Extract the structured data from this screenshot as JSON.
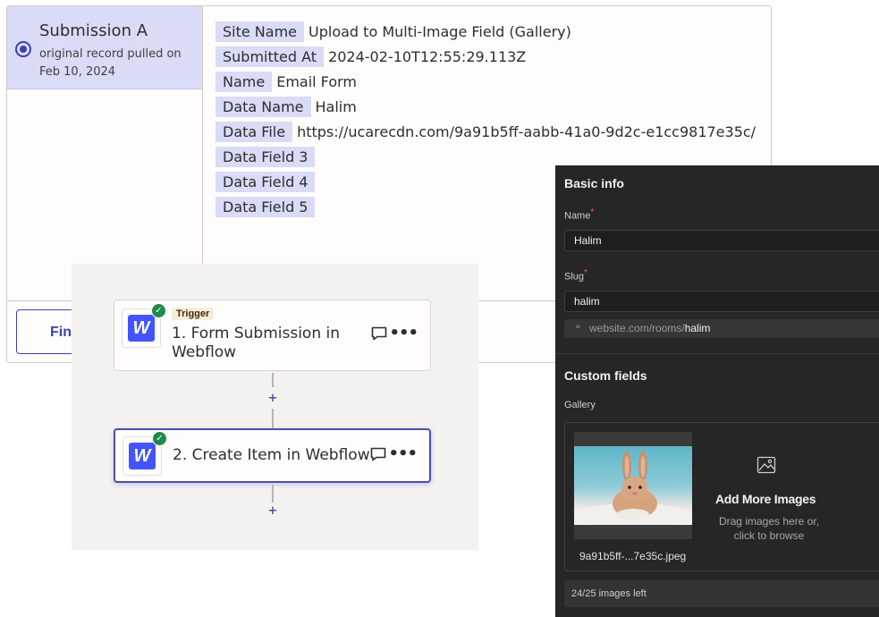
{
  "submission": {
    "title": "Submission A",
    "description": "original record pulled on Feb 10, 2024",
    "find_button": "Fin",
    "fields": [
      {
        "label": "Site Name",
        "value": "Upload to Multi-Image Field (Gallery)"
      },
      {
        "label": "Submitted At",
        "value": "2024-02-10T12:55:29.113Z"
      },
      {
        "label": "Name",
        "value": "Email Form"
      },
      {
        "label": "Data Name",
        "value": "Halim"
      },
      {
        "label": "Data File",
        "value": "https://ucarecdn.com/9a91b5ff-aabb-41a0-9d2c-e1cc9817e35c/"
      },
      {
        "label": "Data Field 3",
        "value": ""
      },
      {
        "label": "Data Field 4",
        "value": ""
      },
      {
        "label": "Data Field 5",
        "value": ""
      }
    ]
  },
  "zap": {
    "steps": [
      {
        "badge": "Trigger",
        "title": "1. Form Submission in Webflow",
        "app_letter": "W"
      },
      {
        "badge": "",
        "title": "2. Create Item in Webflow",
        "app_letter": "W"
      }
    ],
    "plus": "+"
  },
  "webflow": {
    "basic_info": "Basic info",
    "name_label": "Name",
    "name_value": "Halim",
    "slug_label": "Slug",
    "slug_value": "halim",
    "slug_url_prefix": "website.com/rooms/",
    "slug_url_slug": "halim",
    "custom_fields": "Custom fields",
    "gallery_label": "Gallery",
    "image_filename": "9a91b5ff-...7e35c.jpeg",
    "add_more_title": "Add More Images",
    "add_more_sub": "Drag images here or, click to browse",
    "images_left": "24/25 images left",
    "required_mark": "*"
  }
}
